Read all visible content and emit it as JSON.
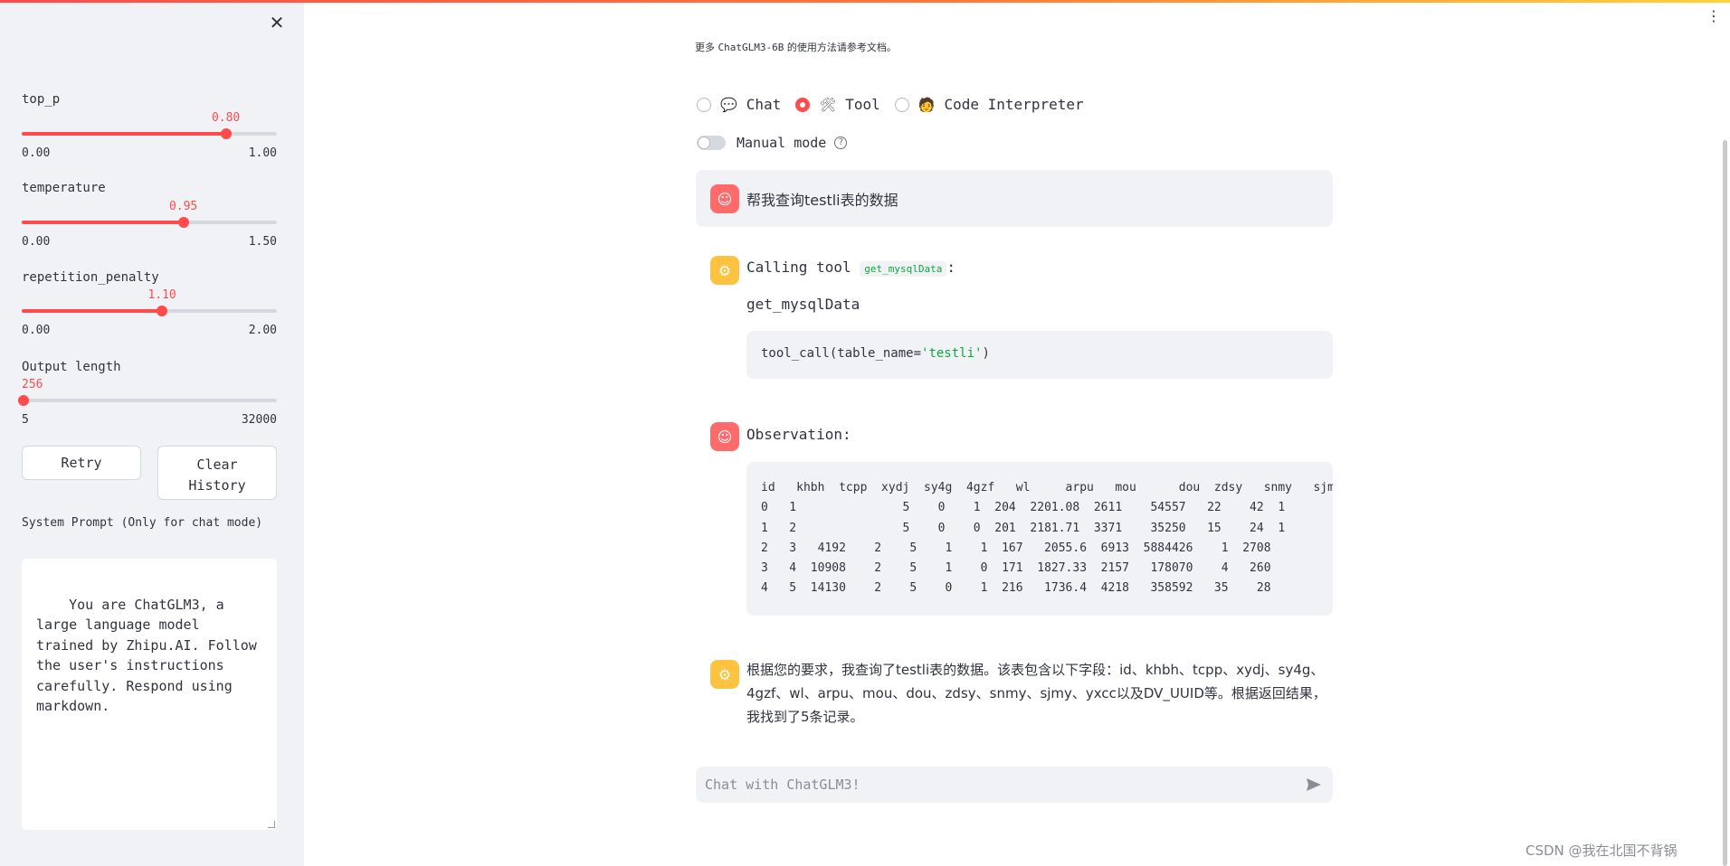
{
  "sidebar": {
    "top_p": {
      "label": "top_p",
      "value": "0.80",
      "value_num": 0.8,
      "min": "0.00",
      "max": "1.00",
      "min_num": 0,
      "max_num": 1
    },
    "temperature": {
      "label": "temperature",
      "value": "0.95",
      "value_num": 0.95,
      "min": "0.00",
      "max": "1.50",
      "min_num": 0,
      "max_num": 1.5
    },
    "repetition_penalty": {
      "label": "repetition_penalty",
      "value": "1.10",
      "value_num": 1.1,
      "min": "0.00",
      "max": "2.00",
      "min_num": 0,
      "max_num": 2
    },
    "output_length": {
      "label": "Output length",
      "value": "256",
      "value_num": 256,
      "min": "5",
      "max": "32000",
      "min_num": 5,
      "max_num": 32000
    },
    "retry_label": "Retry",
    "clear_label_1": "Clear",
    "clear_label_2": "History",
    "system_prompt_label": "System Prompt (Only for chat mode)",
    "system_prompt_value": "You are ChatGLM3, a large language model trained by Zhipu.AI. Follow the user's instructions carefully. Respond using markdown."
  },
  "main": {
    "intro_prefix": "更多",
    "intro_code": "ChatGLM3-6B",
    "intro_suffix": "的使用方法请参考文档。",
    "modes": [
      {
        "label": "Chat",
        "icon": "speech-bubble-icon",
        "glyph": "💬",
        "selected": false
      },
      {
        "label": "Tool",
        "icon": "tools-icon",
        "glyph": "🛠",
        "selected": true
      },
      {
        "label": "Code Interpreter",
        "icon": "technologist-icon",
        "glyph": "🧑",
        "selected": false
      }
    ],
    "manual_mode_label": "Manual mode",
    "help_glyph": "?",
    "messages": {
      "user_text": "帮我查询testli表的数据",
      "calling_prefix": "Calling tool",
      "calling_tool": "get_mysqlData",
      "calling_suffix": ":",
      "tool_name": "get_mysqlData",
      "tool_call_fn": "tool_call(",
      "tool_call_arg": "table_name=",
      "tool_call_str": "'testli'",
      "tool_call_close": ")",
      "observation_label": "Observation:",
      "observation_table": "id   khbh  tcpp  xydj  sy4g  4gzf   wl     arpu   mou      dou  zdsy   snmy   sjmy\n0   1               5    0    1  204  2201.08  2611    54557   22    42  1\n1   2               5    0    0  201  2181.71  3371    35250   15    24  1\n2   3   4192    2    5    1    1  167   2055.6  6913  5884426    1  2708\n3   4  10908    2    5    1    0  171  1827.33  2157   178070    4   260\n4   5  14130    2    5    0    1  216   1736.4  4218   358592   35    28",
      "answer_text": "根据您的要求，我查询了testli表的数据。该表包含以下字段：id、khbh、tcpp、xydj、sy4g、4gzf、wl、arpu、mou、dou、zdsy、snmy、sjmy、yxcc以及DV_UUID等。根据返回结果，我找到了5条记录。"
    },
    "chat_placeholder": "Chat with ChatGLM3!"
  },
  "watermark": "CSDN @我在北国不背锅",
  "colors": {
    "accent": "#ff4b4b",
    "user_avatar": "#ff6b6b",
    "bot_avatar": "#fdc23f",
    "sidebar_bg": "#f0f2f6"
  }
}
